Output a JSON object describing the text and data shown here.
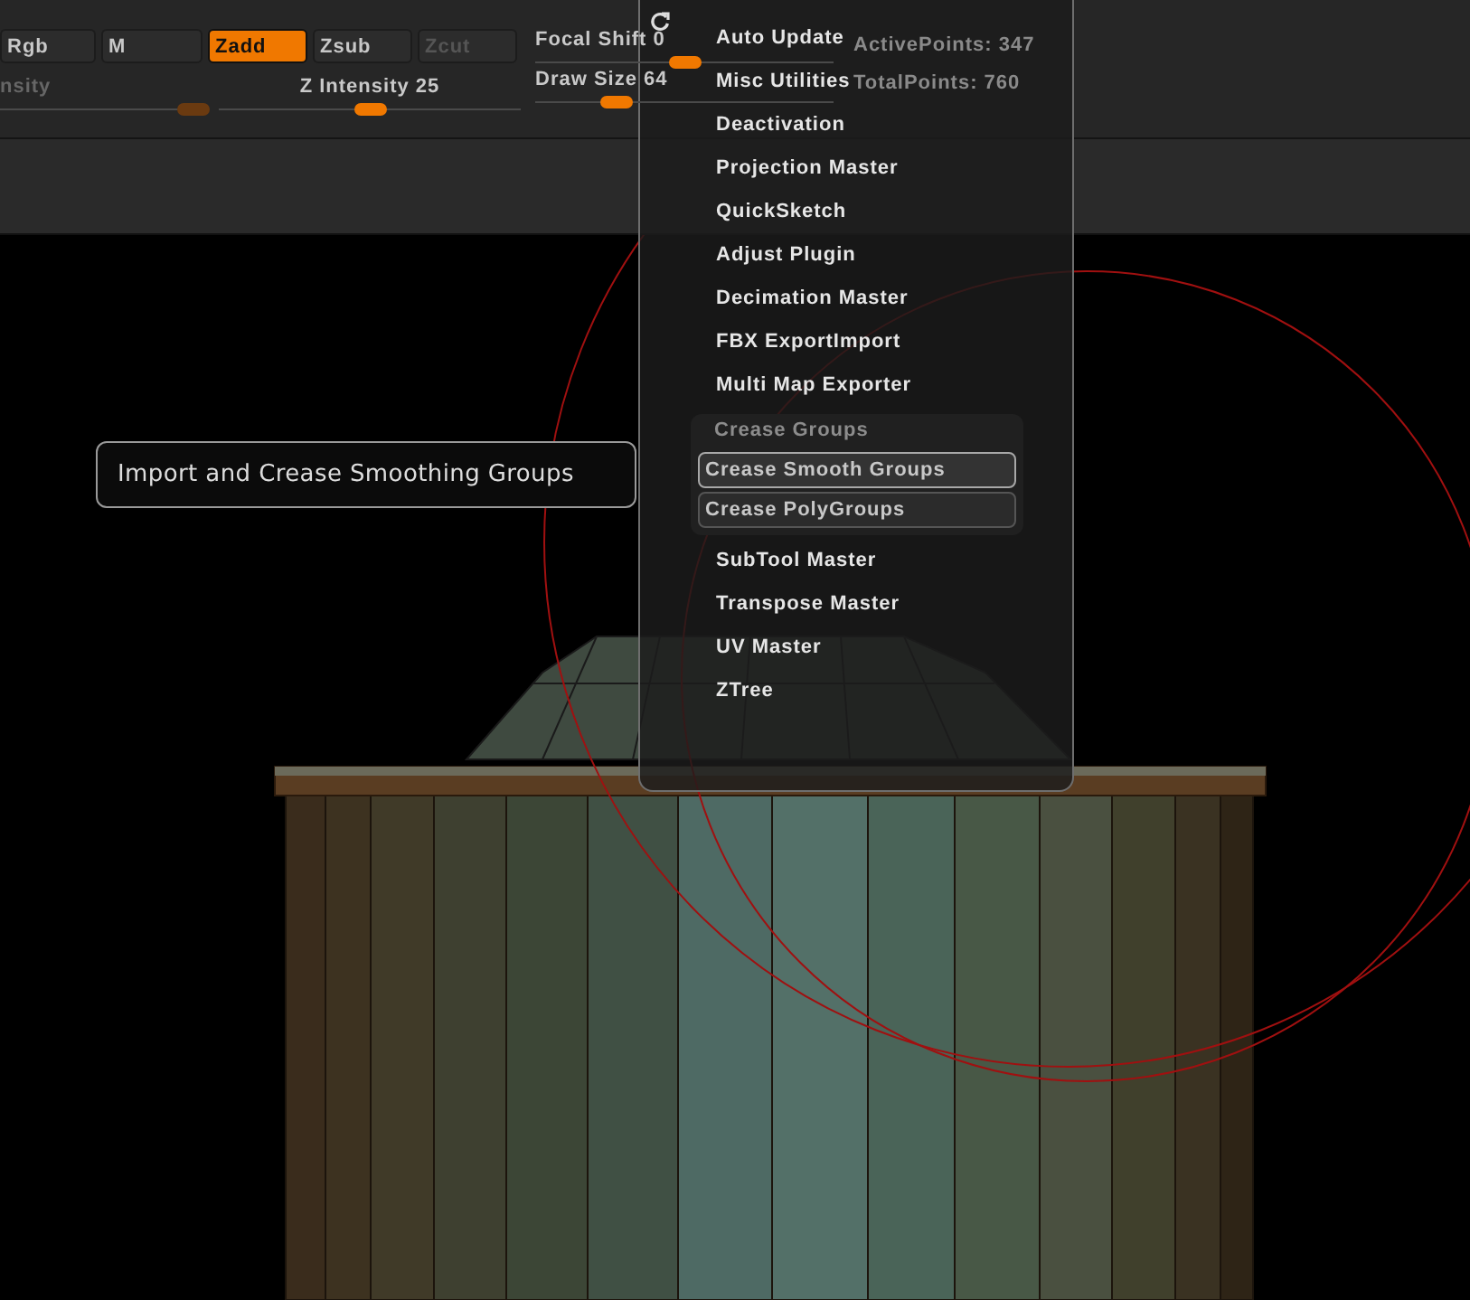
{
  "toolbar": {
    "buttons": [
      {
        "label": "Rgb",
        "selected": false,
        "disabled": false
      },
      {
        "label": "M",
        "selected": false,
        "disabled": false
      },
      {
        "label": "Zadd",
        "selected": true,
        "disabled": false
      },
      {
        "label": "Zsub",
        "selected": false,
        "disabled": false
      },
      {
        "label": "Zcut",
        "selected": false,
        "disabled": true
      }
    ],
    "left_sliders": [
      {
        "label": "nsity",
        "level": 0.93,
        "disabled": true
      },
      {
        "label": "Z Intensity 25",
        "level": 0.5,
        "disabled": false
      }
    ],
    "right_sliders": [
      {
        "label": "Focal Shift 0",
        "level": 0.5,
        "disabled": false
      },
      {
        "label": "Draw Size 64",
        "level": 0.27,
        "disabled": false
      }
    ],
    "stats": [
      "ActivePoints: 347",
      "TotalPoints: 760"
    ]
  },
  "tooltip": "Import and Crease Smoothing Groups",
  "plugin_menu": {
    "items": [
      {
        "kind": "item",
        "label": "Auto Update"
      },
      {
        "kind": "item",
        "label": "Misc Utilities"
      },
      {
        "kind": "item",
        "label": "Deactivation"
      },
      {
        "kind": "item",
        "label": "Projection Master"
      },
      {
        "kind": "item",
        "label": "QuickSketch"
      },
      {
        "kind": "item",
        "label": "Adjust Plugin"
      },
      {
        "kind": "item",
        "label": "Decimation Master"
      },
      {
        "kind": "item",
        "label": "FBX ExportImport"
      },
      {
        "kind": "item",
        "label": "Multi Map Exporter"
      },
      {
        "kind": "group",
        "title": "Crease Groups",
        "buttons": [
          {
            "label": "Crease Smooth Groups",
            "selected": true
          },
          {
            "label": "Crease PolyGroups",
            "selected": false
          }
        ]
      },
      {
        "kind": "item",
        "label": "SubTool Master"
      },
      {
        "kind": "item",
        "label": "Transpose Master"
      },
      {
        "kind": "item",
        "label": "UV Master"
      },
      {
        "kind": "item",
        "label": "ZTree"
      }
    ]
  }
}
